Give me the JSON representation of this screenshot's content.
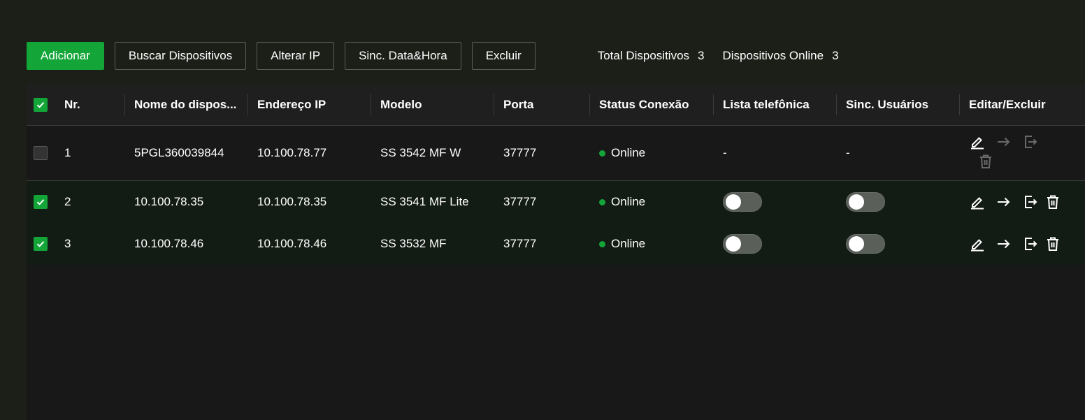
{
  "toolbar": {
    "add_label": "Adicionar",
    "search_label": "Buscar Dispositivos",
    "change_ip_label": "Alterar IP",
    "sync_time_label": "Sinc. Data&Hora",
    "delete_label": "Excluir"
  },
  "stats": {
    "total_label": "Total Dispositivos",
    "total_value": "3",
    "online_label": "Dispositivos Online",
    "online_value": "3"
  },
  "table": {
    "columns": [
      "Nr.",
      "Nome do dispos...",
      "Endereço IP",
      "Modelo",
      "Porta",
      "Status Conexão",
      "Lista telefônica",
      "Sinc. Usuários",
      "Editar/Excluir"
    ],
    "header_checked": true,
    "rows": [
      {
        "checked": false,
        "nr": "1",
        "name": "5PGL360039844",
        "ip": "10.100.78.77",
        "model": "SS 3542 MF W",
        "port": "37777",
        "status": "Online",
        "phonebook": "-",
        "sync_users": "-"
      },
      {
        "checked": true,
        "nr": "2",
        "name": "10.100.78.35",
        "ip": "10.100.78.35",
        "model": "SS 3541 MF Lite",
        "port": "37777",
        "status": "Online",
        "phonebook": "off",
        "sync_users": "off"
      },
      {
        "checked": true,
        "nr": "3",
        "name": "10.100.78.46",
        "ip": "10.100.78.46",
        "model": "SS 3532 MF",
        "port": "37777",
        "status": "Online",
        "phonebook": "off",
        "sync_users": "off"
      }
    ]
  },
  "colors": {
    "accent": "#13a538",
    "background": "#1c1f18",
    "panel": "#181818",
    "selected_row": "#131c14"
  },
  "icons": [
    "check-icon",
    "edit-icon",
    "arrow-right-icon",
    "exit-icon",
    "trash-icon"
  ]
}
